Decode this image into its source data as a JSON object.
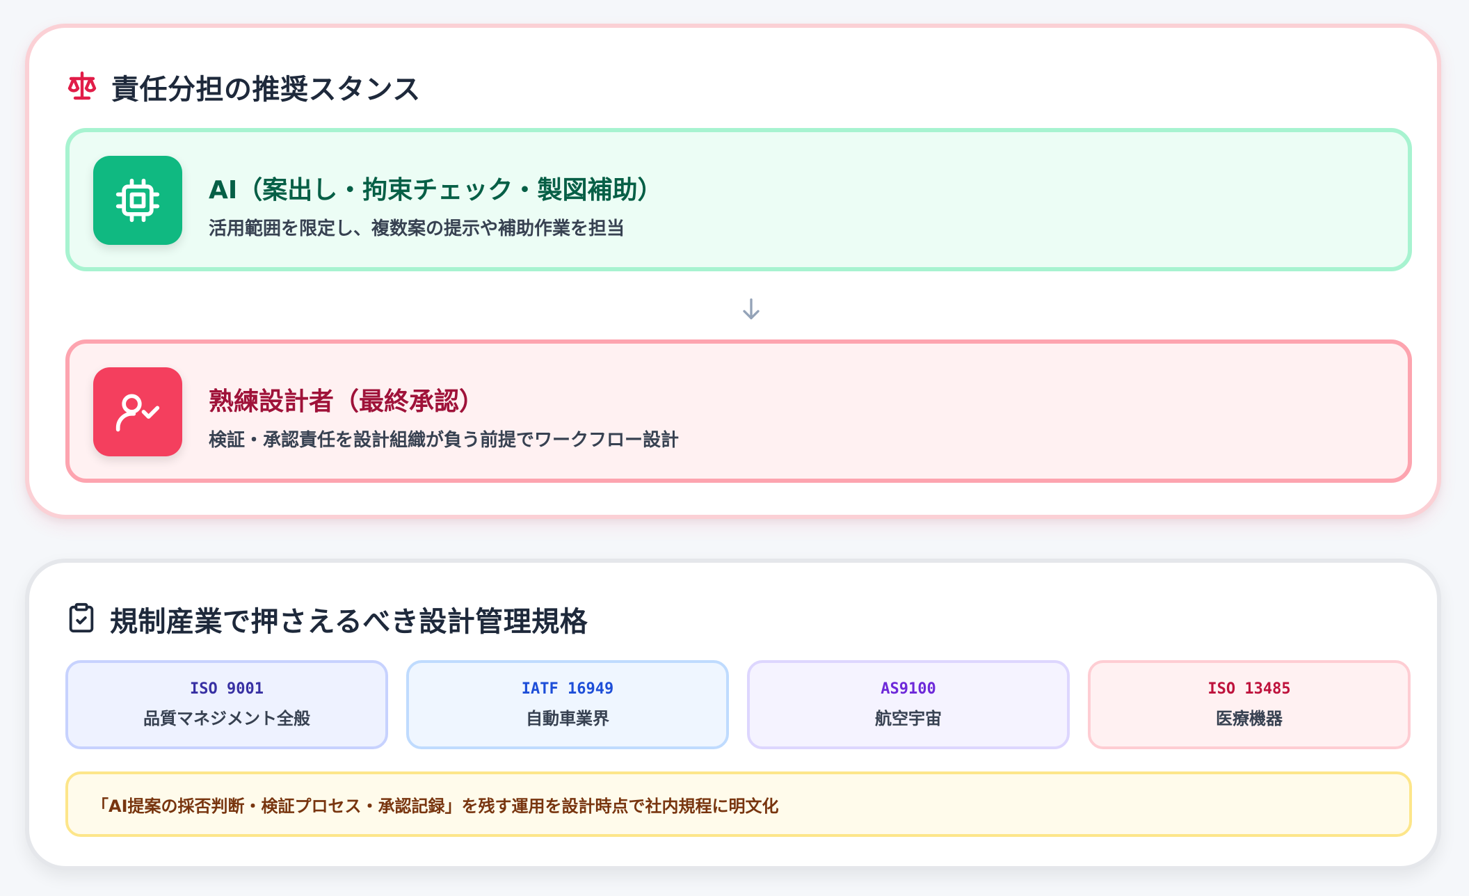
{
  "responsibility": {
    "title": "責任分担の推奨スタンス",
    "ai": {
      "title": "AI（案出し・拘束チェック・製図補助）",
      "desc": "活用範囲を限定し、複数案の提示や補助作業を担当"
    },
    "human": {
      "title": "熟練設計者（最終承認）",
      "desc": "検証・承認責任を設計組織が負う前提でワークフロー設計"
    }
  },
  "standards": {
    "title": "規制産業で押さえるべき設計管理規格",
    "items": [
      {
        "code": "ISO 9001",
        "desc": "品質マネジメント全般"
      },
      {
        "code": "IATF 16949",
        "desc": "自動車業界"
      },
      {
        "code": "AS9100",
        "desc": "航空宇宙"
      },
      {
        "code": "ISO 13485",
        "desc": "医療機器"
      }
    ],
    "note": "「AI提案の採否判断・検証プロセス・承認記録」を残す運用を設計時点で社内規程に明文化"
  },
  "icons": {
    "scale": "scale-icon",
    "cpu": "cpu-icon",
    "user_check": "user-check-icon",
    "arrow_down": "arrow-down-icon",
    "clipboard_check": "clipboard-check-icon"
  },
  "colors": {
    "ai_accent": "#10b981",
    "human_accent": "#f43f5e",
    "heading_icon": "#e11d48"
  }
}
